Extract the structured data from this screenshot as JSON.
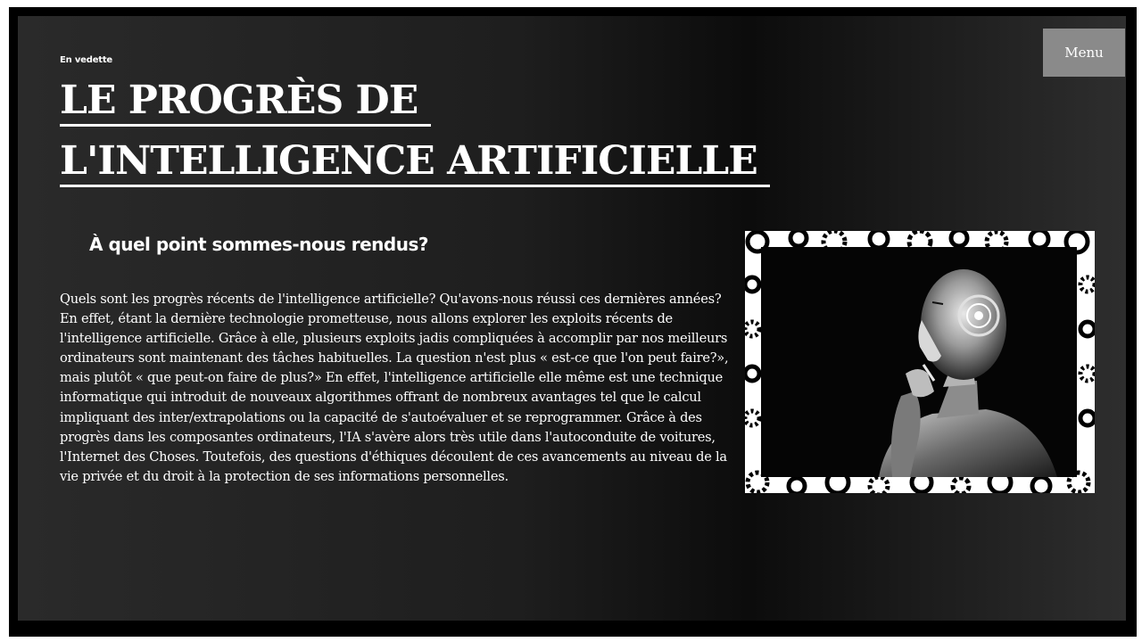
{
  "header": {
    "featured_label": "En vedette",
    "title_line1": "LE PROGRÈS DE ",
    "title_line2": "L'INTELLIGENCE ARTIFICIELLE "
  },
  "nav": {
    "menu_label": "Menu"
  },
  "article": {
    "subheading": "À quel point sommes-nous rendus?",
    "paragraph_intro": "Quels sont les progrès récents de l'intelligence artificielle? Qu'avons-nous réussi ces dernières années?",
    "paragraph_body": "En effet, étant la dernière technologie prometteuse, nous allons explorer les exploits récents de l'intelligence artificielle. Grâce à elle, plusieurs exploits jadis compliquées à accomplir par nos meilleurs ordinateurs sont maintenant des tâches habituelles. La question n'est plus « est-ce que l'on peut faire?», mais plutôt « que peut-on faire de plus?» En effet, l'intelligence artificielle elle même est une technique informatique qui introduit de nouveaux algorithmes offrant de nombreux avantages tel que le calcul impliquant des inter/extrapolations ou la capacité de s'autoévaluer et se reprogrammer. Grâce à des progrès dans les composantes ordinateurs, l'IA s'avère alors très utile dans l'autoconduite de voitures, l'Internet des Choses. Toutefois, des questions d'éthiques découlent de ces avancements au niveau de la vie privée et du droit à la protection de ses informations personnelles."
  },
  "image": {
    "subject": "humanoid-robot-thinking",
    "frame_pattern": "gears"
  },
  "colors": {
    "frame": "#000000",
    "panel": "#1e1e1e",
    "menu_button": "#8a8a8a",
    "text": "#ffffff"
  }
}
